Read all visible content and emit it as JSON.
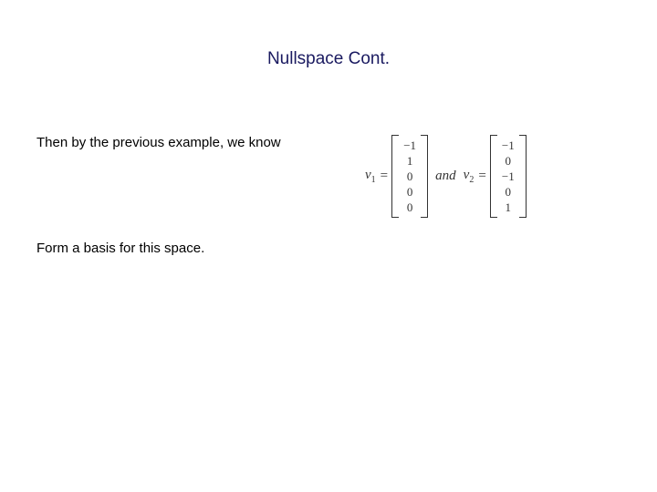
{
  "title": "Nullspace Cont.",
  "body": {
    "line1": "Then by the previous example, we know",
    "line2": "Form a basis for this space."
  },
  "math": {
    "v1_label": "v",
    "v1_sub": "1",
    "eq": "=",
    "and": "and",
    "v2_label": "v",
    "v2_sub": "2",
    "v1": {
      "r0": "−1",
      "r1": "1",
      "r2": "0",
      "r3": "0",
      "r4": "0"
    },
    "v2": {
      "r0": "−1",
      "r1": "0",
      "r2": "−1",
      "r3": "0",
      "r4": "1"
    }
  },
  "chart_data": {
    "type": "table",
    "title": "Basis vectors for nullspace",
    "series": [
      {
        "name": "v1",
        "values": [
          -1,
          1,
          0,
          0,
          0
        ]
      },
      {
        "name": "v2",
        "values": [
          -1,
          0,
          -1,
          0,
          1
        ]
      }
    ]
  }
}
